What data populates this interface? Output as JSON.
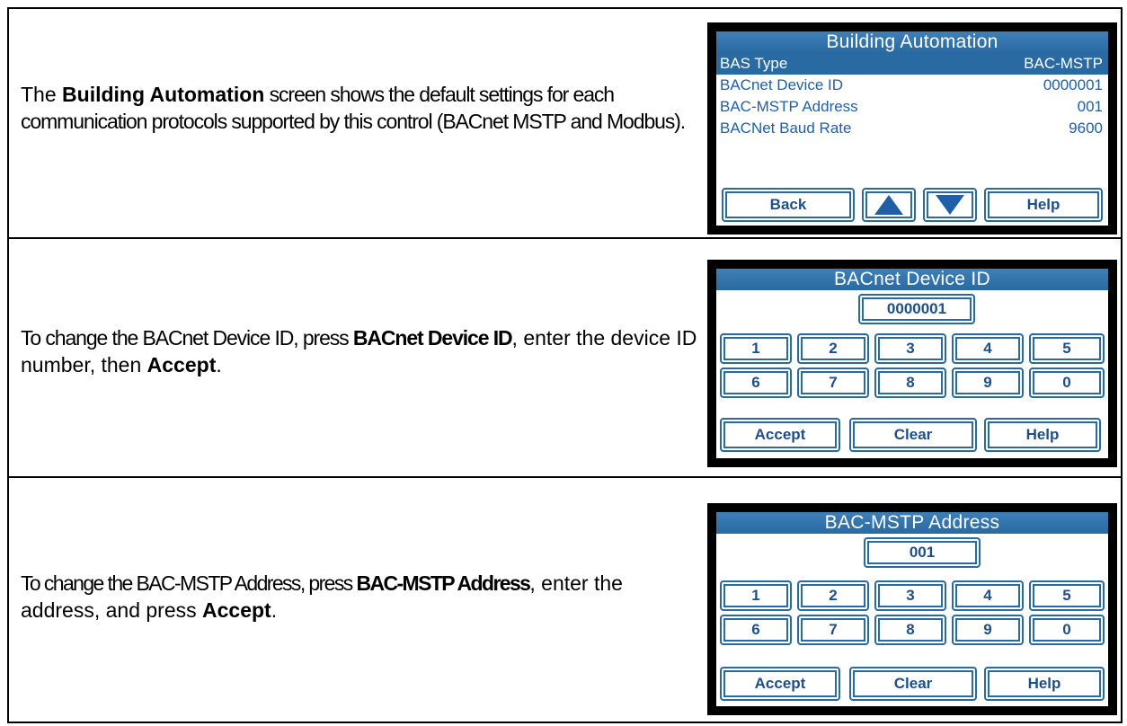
{
  "rows": [
    {
      "description": {
        "segments": [
          "The ",
          "Building Automation",
          " screen shows the default settings for each communication protocols supported by this control (BACnet MSTP and Modbus)."
        ]
      },
      "screen": {
        "title": "Building Automation",
        "settings": [
          {
            "label": "BAS Type",
            "value": "BAC-MSTP"
          },
          {
            "label": "BACnet Device ID",
            "value": "0000001"
          },
          {
            "label": "BAC-MSTP Address",
            "value": "001"
          },
          {
            "label": "BACNet Baud Rate",
            "value": "9600"
          }
        ],
        "buttons": {
          "back": "Back",
          "help": "Help"
        },
        "icons": {
          "up": "up-arrow-icon",
          "down": "down-arrow-icon"
        }
      }
    },
    {
      "description": {
        "segments": [
          "To change the BACnet Device ID, press ",
          "BACnet Device ID",
          ", enter the device ID number, then ",
          "Accept",
          "."
        ]
      },
      "screen": {
        "title": "BACnet Device ID",
        "value": "0000001",
        "keys": [
          "1",
          "2",
          "3",
          "4",
          "5",
          "6",
          "7",
          "8",
          "9",
          "0"
        ],
        "buttons": {
          "accept": "Accept",
          "clear": "Clear",
          "help": "Help"
        }
      }
    },
    {
      "description": {
        "segments": [
          "To change the BAC-MSTP Address, press ",
          "BAC-MSTP Address",
          ", enter the address, and press ",
          "Accept",
          "."
        ]
      },
      "screen": {
        "title": "BAC-MSTP Address",
        "value": "001",
        "keys": [
          "1",
          "2",
          "3",
          "4",
          "5",
          "6",
          "7",
          "8",
          "9",
          "0"
        ],
        "buttons": {
          "accept": "Accept",
          "clear": "Clear",
          "help": "Help"
        }
      }
    }
  ],
  "colors": {
    "title_bar": "#2a6aa3",
    "text_blue": "#1f5fa8",
    "button_text": "#1f4f88",
    "bezel": "#000000"
  }
}
